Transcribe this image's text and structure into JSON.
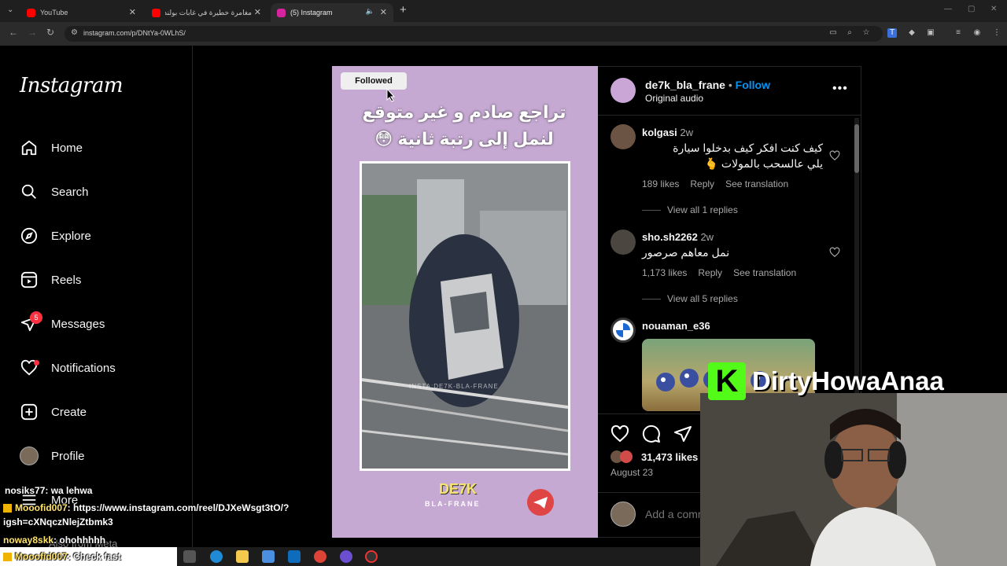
{
  "browser": {
    "tabs": [
      {
        "label": "YouTube",
        "color": "#ff0000"
      },
      {
        "label": "مغامرة خطيرة في غابات بولندا...",
        "color": "#ff0000"
      },
      {
        "label": "(5) Instagram",
        "color": "#d6249f"
      }
    ],
    "url": "instagram.com/p/DNtYa-0WLhS/"
  },
  "sidebar": {
    "logo": "Instagram",
    "items": [
      {
        "label": "Home",
        "icon": "home-icon"
      },
      {
        "label": "Search",
        "icon": "search-icon"
      },
      {
        "label": "Explore",
        "icon": "compass-icon"
      },
      {
        "label": "Reels",
        "icon": "reels-icon"
      },
      {
        "label": "Messages",
        "icon": "messages-icon",
        "badge": "5"
      },
      {
        "label": "Notifications",
        "icon": "heart-icon"
      },
      {
        "label": "Create",
        "icon": "create-icon"
      },
      {
        "label": "Profile",
        "icon": "profile-avatar"
      },
      {
        "label": "More",
        "icon": "menu-icon"
      }
    ],
    "meta_label": "Also from Meta"
  },
  "post": {
    "followed_label": "Followed",
    "caption_line1": "تراجع صادم و غير متوقع",
    "caption_line2": "لنمل إلى رتبة ثانية 😳",
    "video_watermark": "INSTA:DE7K-BLA-FRANE",
    "brand_top": "DE7K",
    "brand_bottom": "BLA-FRANE"
  },
  "panel": {
    "username": "de7k_bla_frane",
    "separator": "•",
    "follow_label": "Follow",
    "audio": "Original audio",
    "comments": [
      {
        "user": "kolgasi",
        "time": "2w",
        "text_line1": "كيف كنت افكر كيف بدخلوا سيارة",
        "text_line2": "يلي عالسحب بالمولات 🫰",
        "likes": "189 likes",
        "reply": "Reply",
        "translate": "See translation",
        "view_replies": "View all 1 replies"
      },
      {
        "user": "sho.sh2262",
        "time": "2w",
        "text_line1": "نمل معاهم صرصور",
        "likes": "1,173 likes",
        "reply": "Reply",
        "translate": "See translation",
        "view_replies": "View all 5 replies"
      },
      {
        "user": "nouaman_e36",
        "time": ""
      }
    ],
    "likes_count": "31,473 likes",
    "date": "August 23",
    "add_comment_placeholder": "Add a comment..."
  },
  "overlay": {
    "streamer_name": "DirtyHowaAnaa",
    "chat": [
      {
        "user": "nosiks77",
        "msg": ": wa lehwa"
      },
      {
        "user": "Mooofid007",
        "msg": ": https://www.instagram.com/reel/DJXeWsgt3tO/?"
      },
      {
        "user": "",
        "msg": "igsh=cXNqczNlejZtbmk3"
      },
      {
        "user": "noway8skk",
        "msg": ": ohohhhhh"
      },
      {
        "user": "Mooofid007",
        "msg": ": Check fast"
      }
    ]
  }
}
